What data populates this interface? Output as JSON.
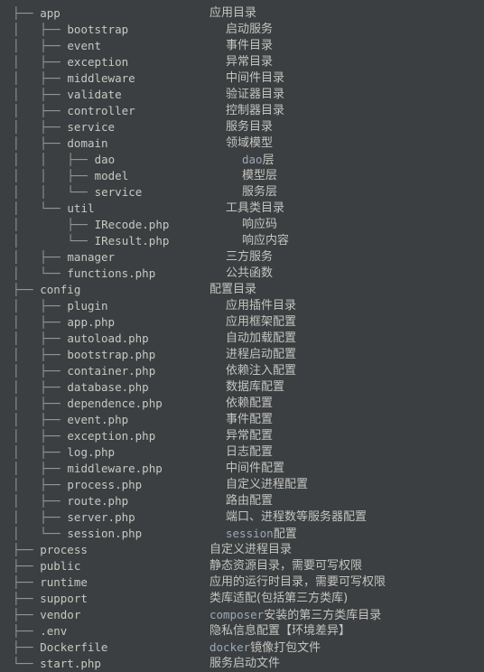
{
  "theme": {
    "background": "#3c3f41",
    "branch_color": "#9a9a95",
    "name_color": "#c8c8c2",
    "desc_color": "#c4c4c0",
    "mono_token_color": "#9aa8b8"
  },
  "glyphs": {
    "tee": "├──",
    "elbow": "└──",
    "pipe": "│",
    "indent": "    "
  },
  "rows": [
    {
      "depth": 0,
      "prefix": "├── ",
      "name": "app",
      "desc": "应用目录",
      "desc_mono": ""
    },
    {
      "depth": 1,
      "prefix": "│   ├── ",
      "name": "bootstrap",
      "desc": "启动服务",
      "desc_mono": ""
    },
    {
      "depth": 1,
      "prefix": "│   ├── ",
      "name": "event",
      "desc": "事件目录",
      "desc_mono": ""
    },
    {
      "depth": 1,
      "prefix": "│   ├── ",
      "name": "exception",
      "desc": "异常目录",
      "desc_mono": ""
    },
    {
      "depth": 1,
      "prefix": "│   ├── ",
      "name": "middleware",
      "desc": "中间件目录",
      "desc_mono": ""
    },
    {
      "depth": 1,
      "prefix": "│   ├── ",
      "name": "validate",
      "desc": "验证器目录",
      "desc_mono": ""
    },
    {
      "depth": 1,
      "prefix": "│   ├── ",
      "name": "controller",
      "desc": "控制器目录",
      "desc_mono": ""
    },
    {
      "depth": 1,
      "prefix": "│   ├── ",
      "name": "service",
      "desc": "服务目录",
      "desc_mono": ""
    },
    {
      "depth": 1,
      "prefix": "│   ├── ",
      "name": "domain",
      "desc": "领域模型",
      "desc_mono": ""
    },
    {
      "depth": 2,
      "prefix": "│   │   ├── ",
      "name": "dao",
      "desc": "层",
      "desc_mono": "dao"
    },
    {
      "depth": 2,
      "prefix": "│   │   ├── ",
      "name": "model",
      "desc": "模型层",
      "desc_mono": ""
    },
    {
      "depth": 2,
      "prefix": "│   │   └── ",
      "name": "service",
      "desc": "服务层",
      "desc_mono": ""
    },
    {
      "depth": 1,
      "prefix": "│   └── ",
      "name": "util",
      "desc": "工具类目录",
      "desc_mono": ""
    },
    {
      "depth": 2,
      "prefix": "│       ├── ",
      "name": "IRecode.php",
      "desc": "响应码",
      "desc_mono": ""
    },
    {
      "depth": 2,
      "prefix": "│       └── ",
      "name": "IResult.php",
      "desc": "响应内容",
      "desc_mono": ""
    },
    {
      "depth": 1,
      "prefix": "│   ├── ",
      "name": "manager",
      "desc": "三方服务",
      "desc_mono": ""
    },
    {
      "depth": 1,
      "prefix": "│   └── ",
      "name": "functions.php",
      "desc": "公共函数",
      "desc_mono": ""
    },
    {
      "depth": 0,
      "prefix": "├── ",
      "name": "config",
      "desc": "配置目录",
      "desc_mono": ""
    },
    {
      "depth": 1,
      "prefix": "│   ├── ",
      "name": "plugin",
      "desc": "应用插件目录",
      "desc_mono": ""
    },
    {
      "depth": 1,
      "prefix": "│   ├── ",
      "name": "app.php",
      "desc": "应用框架配置",
      "desc_mono": ""
    },
    {
      "depth": 1,
      "prefix": "│   ├── ",
      "name": "autoload.php",
      "desc": "自动加载配置",
      "desc_mono": ""
    },
    {
      "depth": 1,
      "prefix": "│   ├── ",
      "name": "bootstrap.php",
      "desc": "进程启动配置",
      "desc_mono": ""
    },
    {
      "depth": 1,
      "prefix": "│   ├── ",
      "name": "container.php",
      "desc": "依赖注入配置",
      "desc_mono": ""
    },
    {
      "depth": 1,
      "prefix": "│   ├── ",
      "name": "database.php",
      "desc": "数据库配置",
      "desc_mono": ""
    },
    {
      "depth": 1,
      "prefix": "│   ├── ",
      "name": "dependence.php",
      "desc": "依赖配置",
      "desc_mono": ""
    },
    {
      "depth": 1,
      "prefix": "│   ├── ",
      "name": "event.php",
      "desc": "事件配置",
      "desc_mono": ""
    },
    {
      "depth": 1,
      "prefix": "│   ├── ",
      "name": "exception.php",
      "desc": "异常配置",
      "desc_mono": ""
    },
    {
      "depth": 1,
      "prefix": "│   ├── ",
      "name": "log.php",
      "desc": "日志配置",
      "desc_mono": ""
    },
    {
      "depth": 1,
      "prefix": "│   ├── ",
      "name": "middleware.php",
      "desc": "中间件配置",
      "desc_mono": ""
    },
    {
      "depth": 1,
      "prefix": "│   ├── ",
      "name": "process.php",
      "desc": "自定义进程配置",
      "desc_mono": ""
    },
    {
      "depth": 1,
      "prefix": "│   ├── ",
      "name": "route.php",
      "desc": "路由配置",
      "desc_mono": ""
    },
    {
      "depth": 1,
      "prefix": "│   ├── ",
      "name": "server.php",
      "desc": "端口、进程数等服务器配置",
      "desc_mono": ""
    },
    {
      "depth": 1,
      "prefix": "│   └── ",
      "name": "session.php",
      "desc": "配置",
      "desc_mono": "session"
    },
    {
      "depth": 0,
      "prefix": "├── ",
      "name": "process",
      "desc": "自定义进程目录",
      "desc_mono": ""
    },
    {
      "depth": 0,
      "prefix": "├── ",
      "name": "public",
      "desc": "静态资源目录，需要可写权限",
      "desc_mono": ""
    },
    {
      "depth": 0,
      "prefix": "├── ",
      "name": "runtime",
      "desc": "应用的运行时目录，需要可写权限",
      "desc_mono": ""
    },
    {
      "depth": 0,
      "prefix": "├── ",
      "name": "support",
      "desc": "类库适配(包括第三方类库)",
      "desc_mono": ""
    },
    {
      "depth": 0,
      "prefix": "├── ",
      "name": "vendor",
      "desc": "安装的第三方类库目录",
      "desc_mono": "composer"
    },
    {
      "depth": 0,
      "prefix": "├── ",
      "name": ".env",
      "desc": "隐私信息配置【环境差异】",
      "desc_mono": ""
    },
    {
      "depth": 0,
      "prefix": "├── ",
      "name": "Dockerfile",
      "desc": "镜像打包文件",
      "desc_mono": "docker"
    },
    {
      "depth": 0,
      "prefix": "└── ",
      "name": "start.php",
      "desc": "服务启动文件",
      "desc_mono": ""
    }
  ]
}
